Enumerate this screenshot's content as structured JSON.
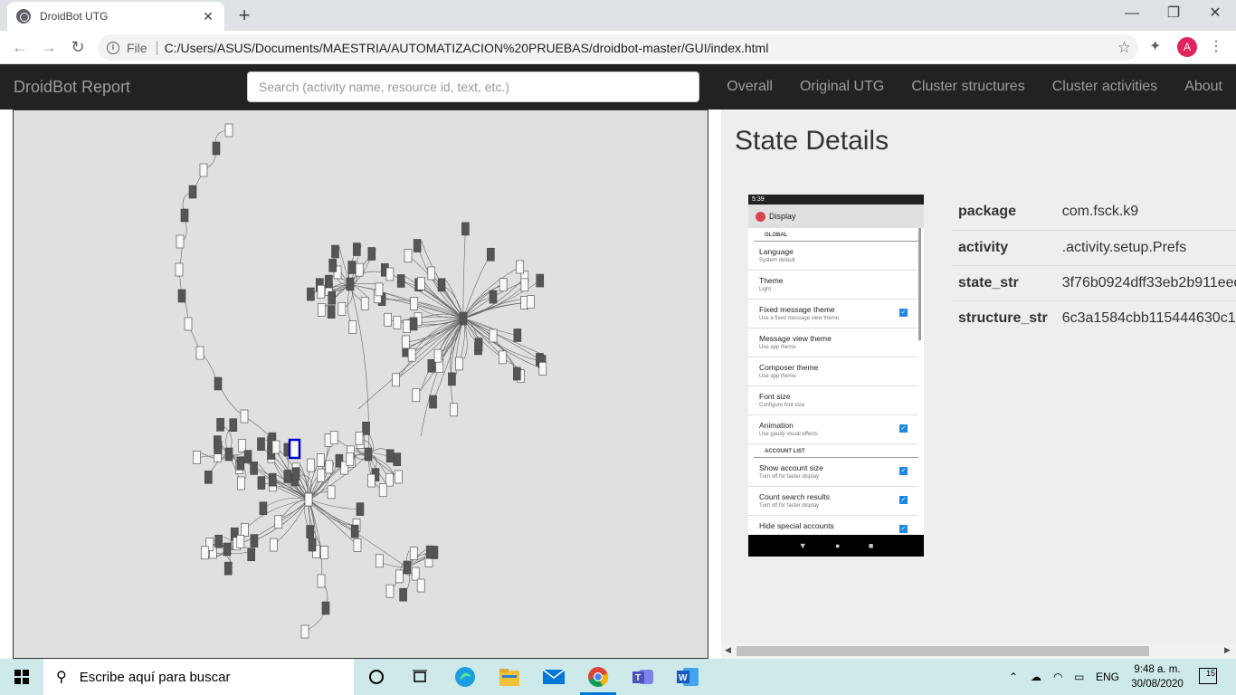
{
  "browser": {
    "tab_title": "DroidBot UTG",
    "close_tab_glyph": "✕",
    "new_tab_glyph": "+",
    "file_label": "File",
    "url": "C:/Users/ASUS/Documents/MAESTRIA/AUTOMATIZACION%20PRUEBAS/droidbot-master/GUI/index.html",
    "profile_initial": "A",
    "window_controls": [
      "—",
      "❐",
      "✕"
    ]
  },
  "navbar": {
    "brand": "DroidBot Report",
    "search_placeholder": "Search (activity name, resource id, text, etc.)",
    "links": [
      "Overall",
      "Original UTG",
      "Cluster structures",
      "Cluster activities",
      "About"
    ]
  },
  "details": {
    "title": "State Details",
    "rows": [
      {
        "key": "package",
        "value": "com.fsck.k9"
      },
      {
        "key": "activity",
        "value": ".activity.setup.Prefs"
      },
      {
        "key": "state_str",
        "value": "3f76b0924dff33eb2b911eed"
      },
      {
        "key": "structure_str",
        "value": "6c3a1584cbb115444630c1"
      }
    ]
  },
  "phone": {
    "status_time": "5:39",
    "app_title": "Display",
    "sections": [
      {
        "header": "GLOBAL",
        "items": [
          {
            "title": "Language",
            "sub": "System default",
            "checked": false
          },
          {
            "title": "Theme",
            "sub": "Light",
            "checked": false
          },
          {
            "title": "Fixed message theme",
            "sub": "Use a fixed message view theme",
            "checked": true
          },
          {
            "title": "Message view theme",
            "sub": "Use app theme",
            "checked": false
          },
          {
            "title": "Composer theme",
            "sub": "Use app theme",
            "checked": false
          },
          {
            "title": "Font size",
            "sub": "Configure font size",
            "checked": false
          },
          {
            "title": "Animation",
            "sub": "Use gaudy visual effects",
            "checked": true
          }
        ]
      },
      {
        "header": "ACCOUNT LIST",
        "items": [
          {
            "title": "Show account size",
            "sub": "Turn off for faster display",
            "checked": true
          },
          {
            "title": "Count search results",
            "sub": "Turn off for faster display",
            "checked": true
          },
          {
            "title": "Hide special accounts",
            "sub": "",
            "checked": true
          }
        ]
      }
    ],
    "nav_glyphs": [
      "▼",
      "●",
      "■"
    ]
  },
  "taskbar": {
    "search_text": "Escribe aquí para buscar",
    "language": "ENG",
    "time": "9:48 a. m.",
    "date": "30/08/2020",
    "notification_count": "15",
    "apps": [
      "cortana-icon",
      "task-view-icon",
      "edge-icon",
      "file-explorer-icon",
      "mail-icon",
      "chrome-icon",
      "teams-icon",
      "word-icon"
    ]
  },
  "colors": {
    "navbar_bg": "#222222",
    "graph_bg": "#e0e0e0",
    "selected_node": "#0000cc",
    "taskbar_bg": "#cde9ea"
  }
}
